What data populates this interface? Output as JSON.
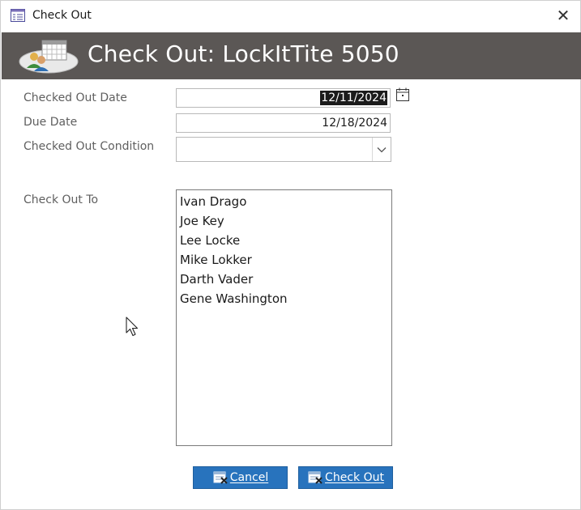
{
  "window": {
    "title": "Check Out",
    "close_glyph": "✕"
  },
  "header": {
    "heading": "Check Out: LockItTite 5050",
    "logo_icon": "calendar-people-icon"
  },
  "form": {
    "checked_out_date": {
      "label": "Checked Out Date",
      "value": "12/11/2024"
    },
    "due_date": {
      "label": "Due Date",
      "value": "12/18/2024"
    },
    "checked_out_condition": {
      "label": "Checked Out Condition",
      "value": ""
    },
    "check_out_to": {
      "label": "Check Out To",
      "options": [
        "Ivan Drago",
        "Joe Key",
        "Lee Locke",
        "Mike Lokker",
        "Darth Vader",
        "Gene Washington"
      ]
    }
  },
  "buttons": {
    "cancel": "Cancel",
    "check_out": "Check Out"
  },
  "colors": {
    "header_bg": "#5b5755",
    "button_bg": "#2873bd"
  }
}
